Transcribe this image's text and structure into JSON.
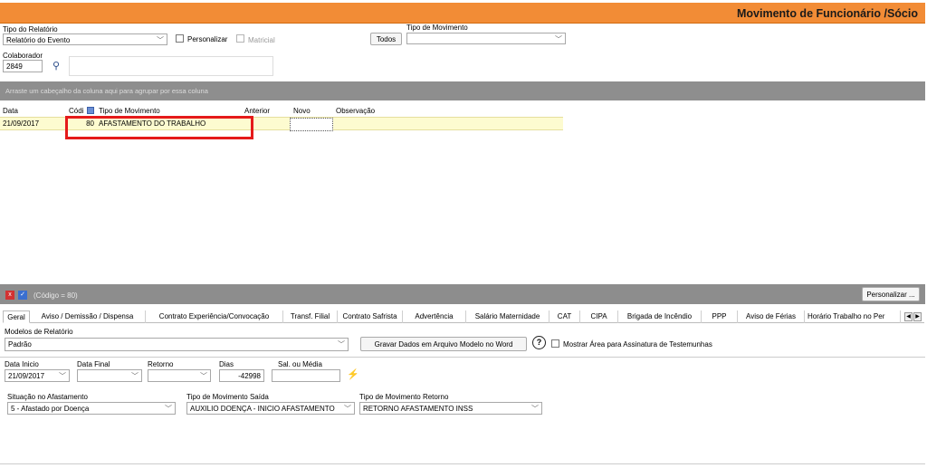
{
  "header": {
    "title": "Movimento de Funcionário /Sócio"
  },
  "filters": {
    "tipo_relatorio_label": "Tipo do Relatório",
    "tipo_relatorio_value": "Relatório do Evento",
    "personalizar_label": "Personalizar",
    "matricial_label": "Matricial",
    "tipo_movimento_label": "Tipo de Movimento",
    "todos_label": "Todos",
    "tipo_movimento_value": "",
    "colaborador_label": "Colaborador",
    "colaborador_value": "2849",
    "colaborador_name": ""
  },
  "grid": {
    "group_hint": "Arraste um cabeçalho da coluna aqui para agrupar por essa coluna",
    "columns": [
      "Data",
      "Códi",
      "Tipo de Movimento",
      "Anterior",
      "Novo",
      "Observação"
    ],
    "rows": [
      {
        "data": "21/09/2017",
        "codigo": "80",
        "tipo": "AFASTAMENTO DO TRABALHO",
        "anterior": "",
        "novo": "",
        "obs": ""
      }
    ]
  },
  "detail": {
    "filter_text": "(Código = 80)",
    "personalizar_btn": "Personalizar ...",
    "tabs": [
      "Geral",
      "Aviso / Demissão / Dispensa",
      "Contrato Experiência/Convocação",
      "Transf. Filial",
      "Contrato Safrista",
      "Advertência",
      "Salário Maternidade",
      "CAT",
      "CIPA",
      "Brigada de Incêndio",
      "PPP",
      "Aviso de Férias",
      "Horário Trabalho no Per"
    ],
    "modelos_label": "Modelos de Relatório",
    "modelos_value": "Padrão",
    "gravar_btn": "Gravar Dados em Arquivo Modelo no Word",
    "help_symbol": "?",
    "mostrar_area_label": "Mostrar Área para Assinatura de Testemunhas",
    "data_inicio_label": "Data Inicio",
    "data_inicio_value": "21/09/2017",
    "data_final_label": "Data Final",
    "data_final_value": "",
    "retorno_label": "Retorno",
    "retorno_value": "",
    "dias_label": "Dias",
    "dias_value": "-42998",
    "sal_label": "Sal. ou Média",
    "sal_value": "",
    "situacao_label": "Situação no Afastamento",
    "situacao_value": "5 - Afastado por Doença",
    "mov_saida_label": "Tipo de Movimento Saída",
    "mov_saida_value": "AUXILIO DOENÇA - INICIO AFASTAMENTO",
    "mov_retorno_label": "Tipo de Movimento Retorno",
    "mov_retorno_value": "RETORNO AFASTAMENTO INSS"
  },
  "colors": {
    "accent": "#f28c36",
    "highlight": "#e51a1a",
    "row_bg": "#fdfbd0"
  }
}
